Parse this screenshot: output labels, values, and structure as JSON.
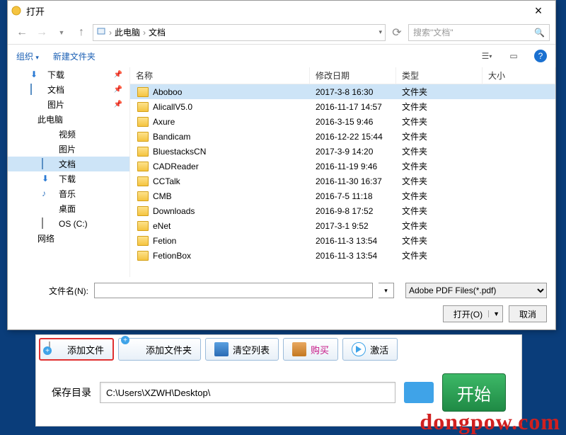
{
  "dialog": {
    "title": "打开",
    "breadcrumb": {
      "root": "此电脑",
      "current": "文档"
    },
    "search_placeholder": "搜索\"文档\"",
    "toolbar": {
      "organize": "组织",
      "new_folder": "新建文件夹"
    },
    "columns": {
      "name": "名称",
      "date": "修改日期",
      "type": "类型",
      "size": "大小"
    },
    "sidebar": [
      {
        "label": "下载",
        "icon": "down-arrow",
        "pin": true
      },
      {
        "label": "文档",
        "icon": "doc",
        "pin": true
      },
      {
        "label": "图片",
        "icon": "pic",
        "pin": true
      },
      {
        "label": "此电脑",
        "icon": "pc",
        "header": true
      },
      {
        "label": "视频",
        "icon": "vid",
        "indent": true
      },
      {
        "label": "图片",
        "icon": "pic",
        "indent": true
      },
      {
        "label": "文档",
        "icon": "doc",
        "indent": true,
        "selected": true
      },
      {
        "label": "下载",
        "icon": "down-arrow",
        "indent": true
      },
      {
        "label": "音乐",
        "icon": "music",
        "indent": true
      },
      {
        "label": "桌面",
        "icon": "desk",
        "indent": true
      },
      {
        "label": "OS (C:)",
        "icon": "drive",
        "indent": true
      },
      {
        "label": "网络",
        "icon": "net",
        "header": true
      }
    ],
    "files": [
      {
        "name": "Aboboo",
        "date": "2017-3-8 16:30",
        "type": "文件夹",
        "selected": true
      },
      {
        "name": "AlicallV5.0",
        "date": "2016-11-17 14:57",
        "type": "文件夹"
      },
      {
        "name": "Axure",
        "date": "2016-3-15 9:46",
        "type": "文件夹"
      },
      {
        "name": "Bandicam",
        "date": "2016-12-22 15:44",
        "type": "文件夹"
      },
      {
        "name": "BluestacksCN",
        "date": "2017-3-9 14:20",
        "type": "文件夹"
      },
      {
        "name": "CADReader",
        "date": "2016-11-19 9:46",
        "type": "文件夹"
      },
      {
        "name": "CCTalk",
        "date": "2016-11-30 16:37",
        "type": "文件夹"
      },
      {
        "name": "CMB",
        "date": "2016-7-5 11:18",
        "type": "文件夹"
      },
      {
        "name": "Downloads",
        "date": "2016-9-8 17:52",
        "type": "文件夹"
      },
      {
        "name": "eNet",
        "date": "2017-3-1 9:52",
        "type": "文件夹"
      },
      {
        "name": "Fetion",
        "date": "2016-11-3 13:54",
        "type": "文件夹"
      },
      {
        "name": "FetionBox",
        "date": "2016-11-3 13:54",
        "type": "文件夹"
      }
    ],
    "filename_label": "文件名(N):",
    "filename_value": "",
    "filetype": "Adobe PDF Files(*.pdf)",
    "open_btn": "打开(O)",
    "cancel_btn": "取消"
  },
  "app": {
    "buttons": {
      "add_file": "添加文件",
      "add_folder": "添加文件夹",
      "clear_list": "清空列表",
      "buy": "购买",
      "activate": "激活"
    },
    "save_dir_label": "保存目录",
    "save_dir_value": "C:\\Users\\XZWH\\Desktop\\",
    "start": "开始"
  },
  "watermark": "dongpow.com"
}
